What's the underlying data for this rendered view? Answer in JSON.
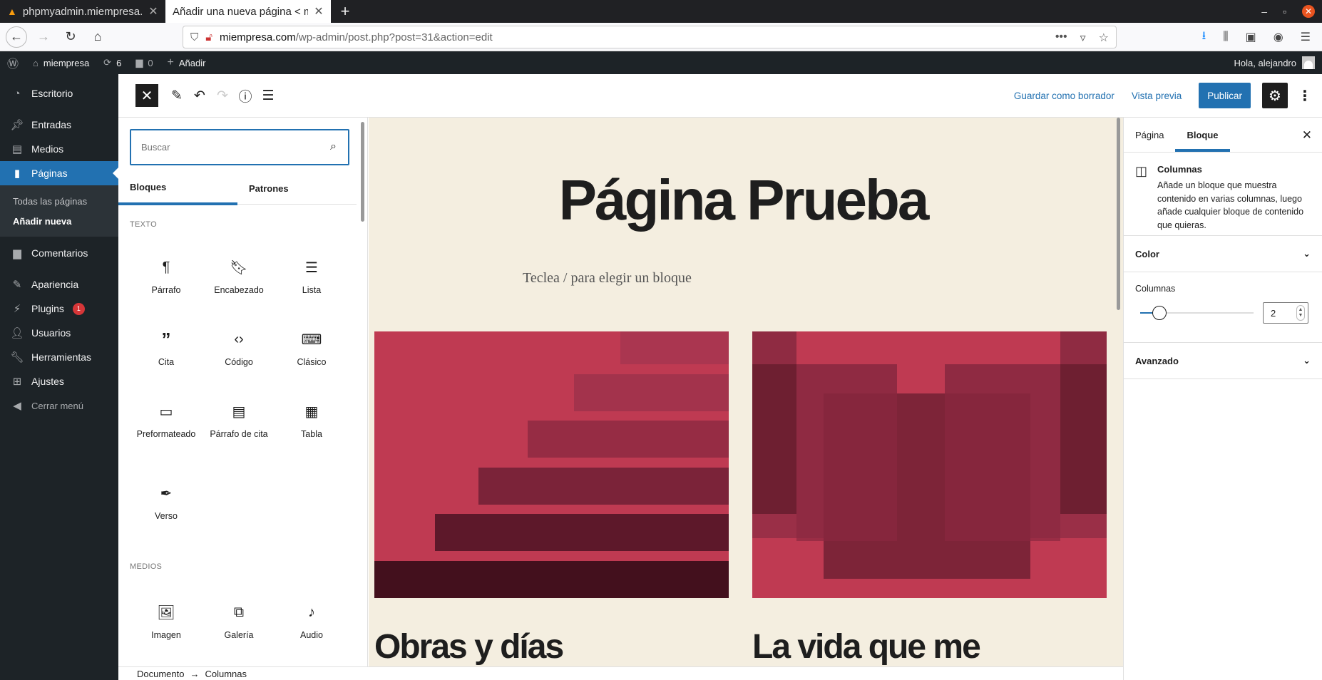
{
  "browser": {
    "tabs": [
      {
        "title": "phpmyadmin.miempresa.com",
        "active": false
      },
      {
        "title": "Añadir una nueva página < miempresa",
        "active": true
      }
    ],
    "url_domain": "miempresa.com",
    "url_path": "/wp-admin/post.php?post=31&action=edit"
  },
  "adminbar": {
    "site": "miempresa",
    "updates": "6",
    "comments": "0",
    "new": "Añadir",
    "greeting": "Hola, alejandro"
  },
  "menu": {
    "items": [
      {
        "label": "Escritorio",
        "icon": "dashboard-icon"
      },
      {
        "label": "Entradas",
        "icon": "pin-icon"
      },
      {
        "label": "Medios",
        "icon": "media-icon"
      },
      {
        "label": "Páginas",
        "icon": "pages-icon"
      },
      {
        "label": "Comentarios",
        "icon": "comment-icon"
      },
      {
        "label": "Apariencia",
        "icon": "brush-icon"
      },
      {
        "label": "Plugins",
        "icon": "plugin-icon",
        "badge": "1"
      },
      {
        "label": "Usuarios",
        "icon": "user-icon"
      },
      {
        "label": "Herramientas",
        "icon": "wrench-icon"
      },
      {
        "label": "Ajustes",
        "icon": "settings-icon"
      },
      {
        "label": "Cerrar menú",
        "icon": "collapse-icon"
      }
    ],
    "sub": [
      "Todas las páginas",
      "Añadir nueva"
    ]
  },
  "header": {
    "save_draft": "Guardar como borrador",
    "preview": "Vista previa",
    "publish": "Publicar"
  },
  "inserter": {
    "search_placeholder": "Buscar",
    "tabs": [
      "Bloques",
      "Patrones"
    ],
    "categories": [
      "Texto",
      "Medios"
    ],
    "text_blocks": [
      "Párrafo",
      "Encabezado",
      "Lista",
      "Cita",
      "Código",
      "Clásico",
      "Preformateado",
      "Párrafo de cita",
      "Tabla",
      "Verso"
    ],
    "media_blocks": [
      "Imagen",
      "Galería",
      "Audio"
    ]
  },
  "canvas": {
    "title": "Página Prueba",
    "placeholder": "Teclea / para elegir un bloque",
    "col1_title": "Obras y días",
    "col2_title": "La vida que me"
  },
  "sidebar": {
    "tabs": [
      "Página",
      "Bloque"
    ],
    "block_name": "Columnas",
    "block_desc": "Añade un bloque que muestra contenido en varias columnas, luego añade cualquier bloque de contenido que quieras.",
    "panel_color": "Color",
    "columns_label": "Columnas",
    "columns_value": "2",
    "columns_slider_fraction": 0.17,
    "panel_advanced": "Avanzado"
  },
  "footer": {
    "crumbs": [
      "Documento",
      "Columnas"
    ]
  },
  "colors": {
    "accent": "#2271b1",
    "admin_bg": "#1d2327",
    "canvas_bg": "#f4eee0",
    "image_red": "#bf3a52"
  }
}
